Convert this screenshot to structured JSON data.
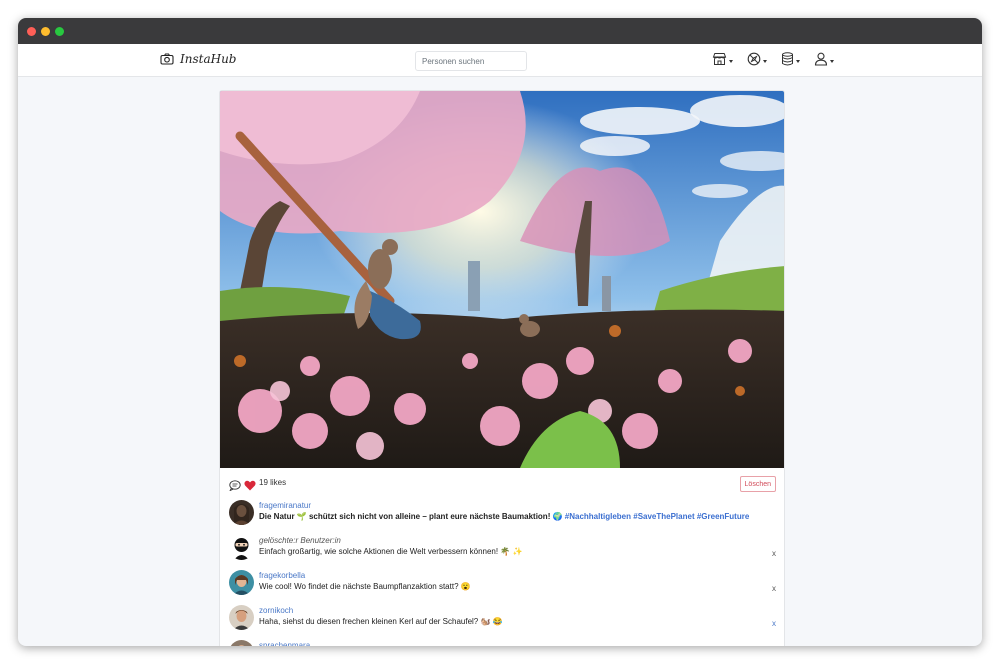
{
  "window": {
    "traffic_lights": [
      "close",
      "minimize",
      "zoom"
    ]
  },
  "navbar": {
    "brand": "InstaHub",
    "brand_icon": "camera-icon",
    "search_placeholder": "Personen suchen",
    "icons": [
      "shop-icon",
      "compass-icon",
      "database-icon",
      "user-icon"
    ]
  },
  "post": {
    "image_alt": "Squirrels and a shovel in soil with pink blossoms under cherry trees",
    "likes": "19 likes",
    "delete_label": "Löschen",
    "caption": {
      "username": "fragemiranatur",
      "text_prefix": "Die Natur 🌱 schützt sich nicht von alleine – plant eure nächste Baumaktion! 🌍",
      "hashtags": "#Nachhaltigleben #SaveThePlanet #GreenFuture"
    },
    "comments": [
      {
        "username": "gelöschte:r Benutzer:in",
        "text": "Einfach großartig, wie solche Aktionen die Welt verbessern können! 🌴 ✨",
        "close": "x"
      },
      {
        "username": "fragekorbella",
        "text": "Wie cool! Wo findet die nächste Baumpflanzaktion statt? 😮",
        "close": "x"
      },
      {
        "username": "zornikoch",
        "text": "Haha, siehst du diesen frechen kleinen Kerl auf der Schaufel? 🐿️ 😂",
        "close": "x"
      },
      {
        "username": "sprachenmara",
        "text": "",
        "close": ""
      }
    ]
  },
  "colors": {
    "link": "#4a78c7",
    "hashtag": "#3b6fd0",
    "danger": "#d14a58",
    "heart": "#d9283a"
  }
}
